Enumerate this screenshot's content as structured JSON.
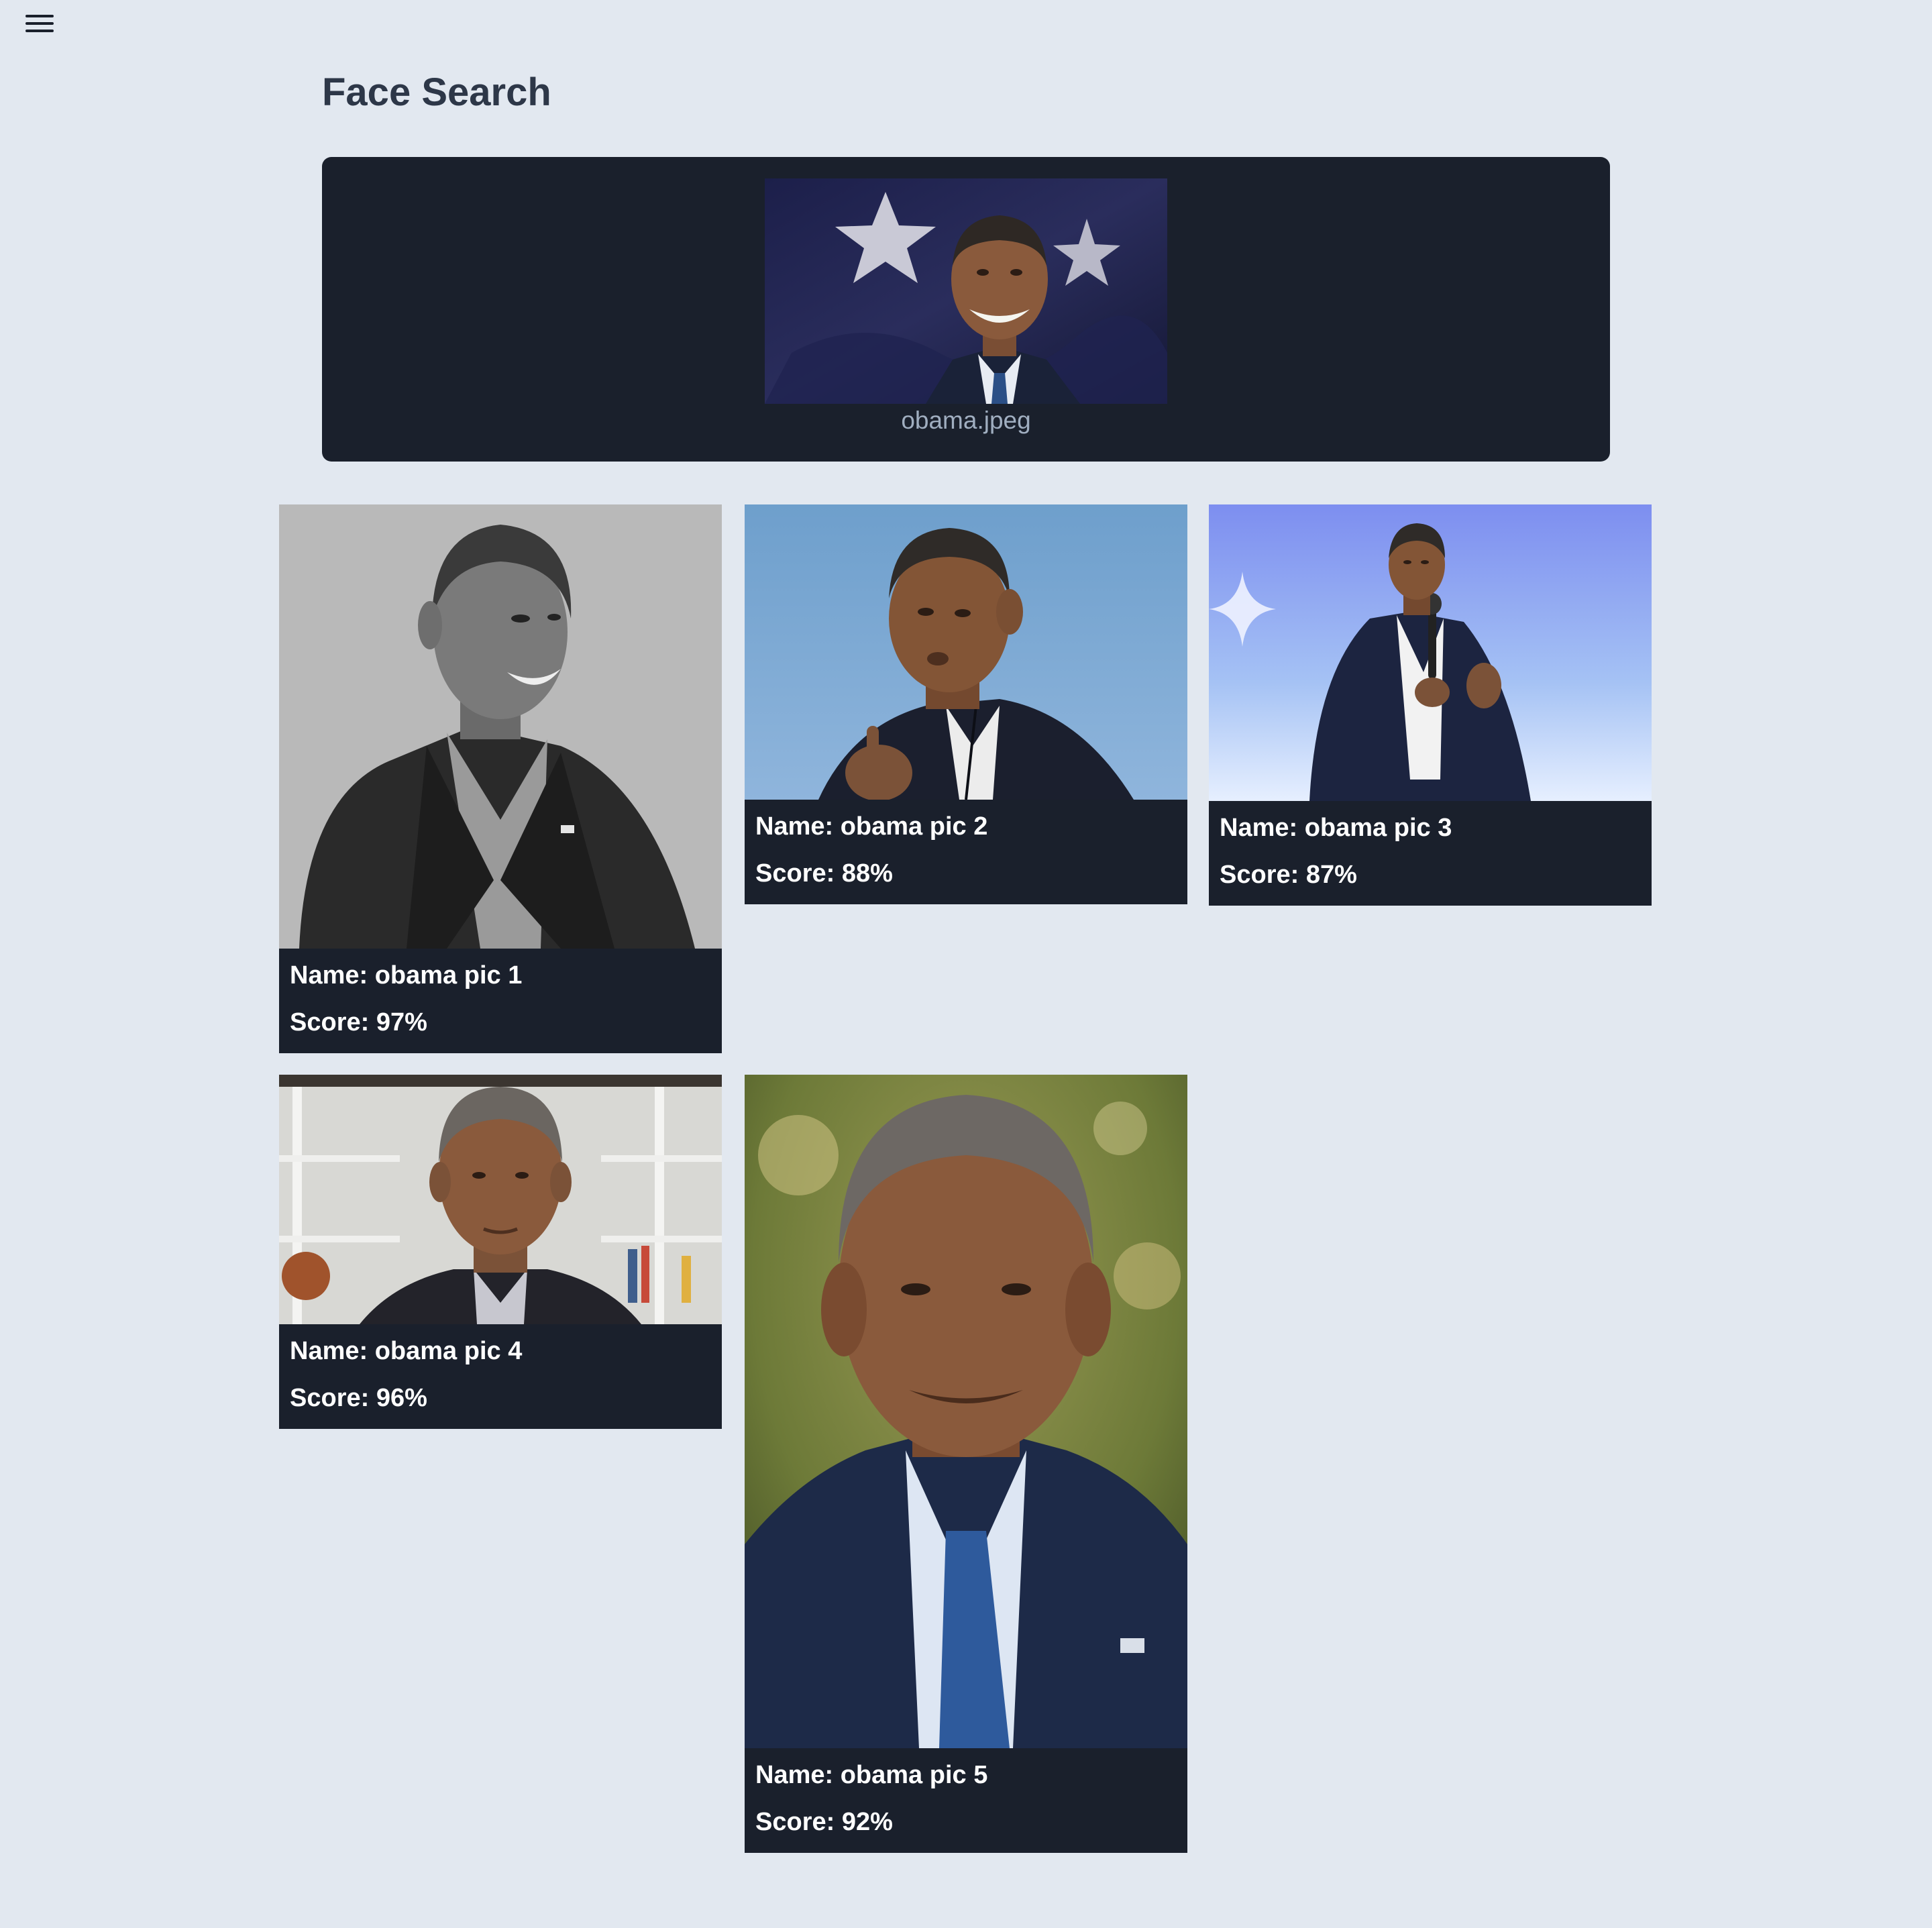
{
  "header": {
    "title": "Face Search",
    "menu_icon": "hamburger-menu-icon"
  },
  "query": {
    "filename": "obama.jpeg"
  },
  "results": [
    {
      "name": "Name: obama pic 1",
      "score": "Score: 97%"
    },
    {
      "name": "Name: obama pic 2",
      "score": "Score: 88%"
    },
    {
      "name": "Name: obama pic 3",
      "score": "Score: 87%"
    },
    {
      "name": "Name: obama pic 4",
      "score": "Score: 96%"
    },
    {
      "name": "Name: obama pic 5",
      "score": "Score: 92%"
    }
  ],
  "colors": {
    "page_background": "#e2e8f0",
    "panel_background": "#1a202c",
    "title_text": "#2d3748",
    "caption_text": "#a0aec0",
    "card_text": "#ffffff"
  }
}
